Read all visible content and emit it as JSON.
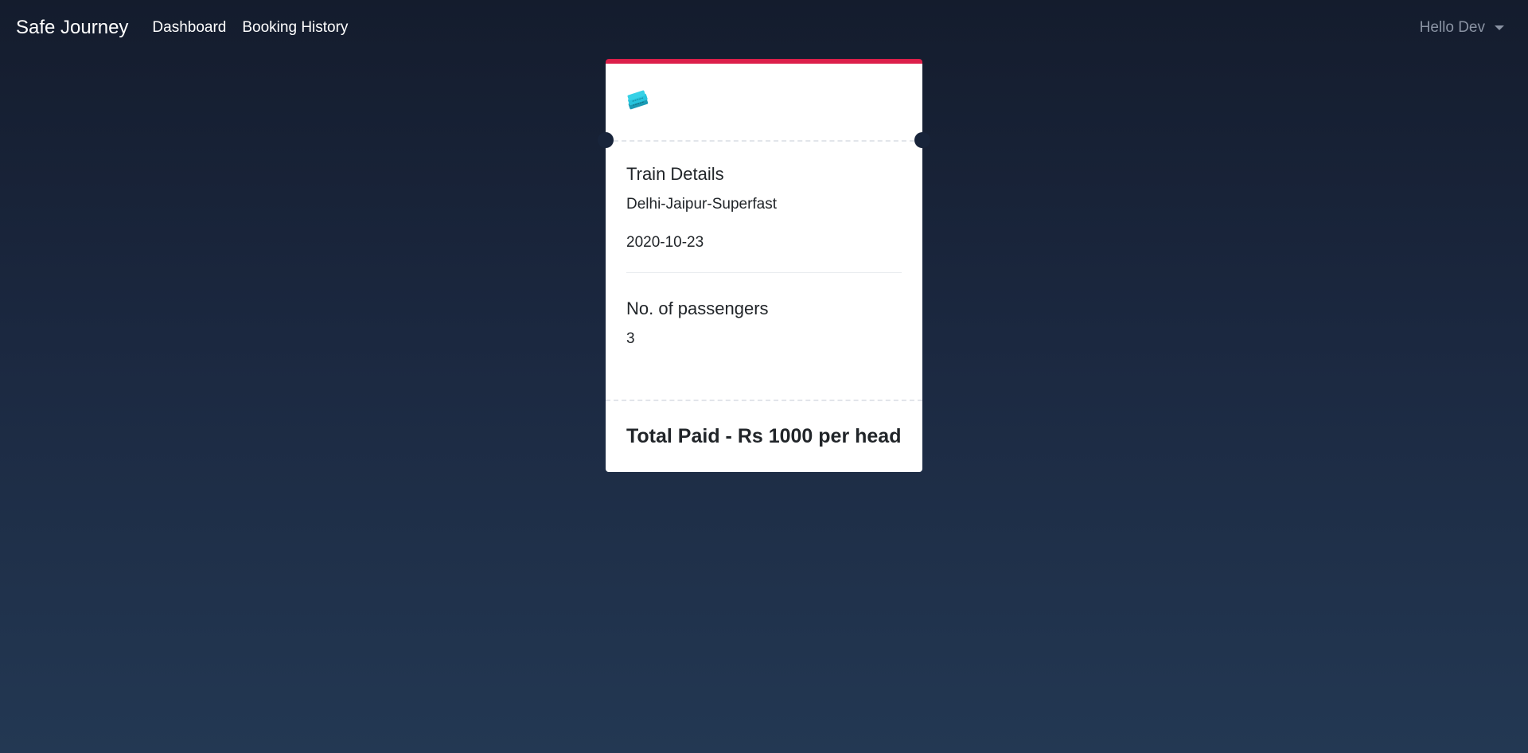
{
  "nav": {
    "brand": "Safe Journey",
    "links": [
      {
        "label": "Dashboard"
      },
      {
        "label": "Booking History"
      }
    ],
    "user": "Hello Dev"
  },
  "ticket": {
    "icon": "ticket-icon",
    "accent_color": "#dc1f4a",
    "train_section_title": "Train Details",
    "train_name": "Delhi-Jaipur-Superfast",
    "date": "2020-10-23",
    "passengers_title": "No. of passengers",
    "passengers_count": "3",
    "total": "Total Paid - Rs 1000 per head"
  }
}
